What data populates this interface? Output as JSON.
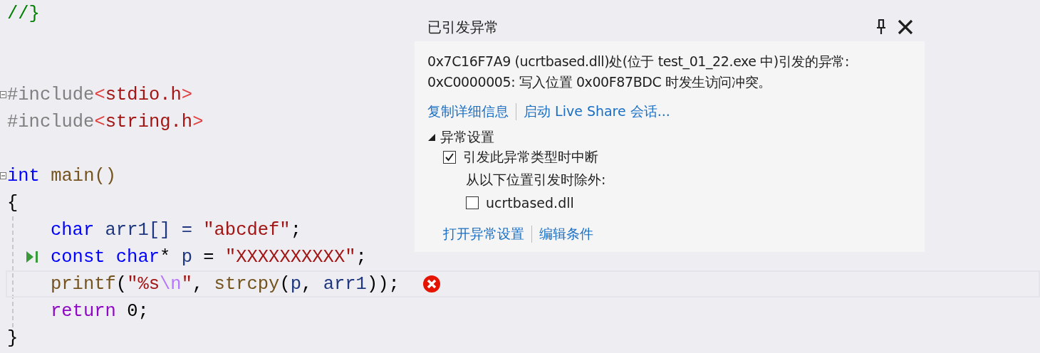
{
  "editor": {
    "lines": [
      {
        "current": false,
        "fold": false,
        "next_statement": false,
        "error": false,
        "tokens": [
          {
            "text": "//}",
            "kind": "comment"
          }
        ]
      },
      {
        "current": false,
        "fold": false,
        "next_statement": false,
        "error": false
      },
      {
        "current": false,
        "fold": false,
        "next_statement": false,
        "error": false
      },
      {
        "current": false,
        "fold": true,
        "next_statement": false,
        "error": false,
        "tokens": [
          {
            "text": "#include",
            "kind": "preproc"
          },
          {
            "text": "<",
            "kind": "angle"
          },
          {
            "text": "stdio.h",
            "kind": "string"
          },
          {
            "text": ">",
            "kind": "angle"
          }
        ]
      },
      {
        "current": false,
        "fold": false,
        "next_statement": false,
        "error": false,
        "tokens": [
          {
            "text": "#include",
            "kind": "preproc"
          },
          {
            "text": "<",
            "kind": "angle"
          },
          {
            "text": "string.h",
            "kind": "string"
          },
          {
            "text": ">",
            "kind": "angle"
          }
        ]
      },
      {
        "current": false,
        "fold": false,
        "next_statement": false,
        "error": false
      },
      {
        "current": false,
        "fold": true,
        "next_statement": false,
        "error": false,
        "tokens": [
          {
            "text": "int",
            "kind": "keyword"
          },
          {
            "text": " main()",
            "kind": "function"
          }
        ]
      },
      {
        "current": false,
        "fold": false,
        "next_statement": false,
        "error": false,
        "tokens": [
          {
            "text": "{",
            "kind": "plain"
          }
        ],
        "children": [
          {
            "current": false,
            "fold": false,
            "next_statement": false,
            "error": false,
            "tokens": [
              {
                "text": "char",
                "kind": "keyword"
              },
              {
                "text": " arr1[] = ",
                "kind": "variable"
              },
              {
                "text": "\"abcdef\"",
                "kind": "string"
              },
              {
                "text": ";",
                "kind": "plain"
              }
            ]
          },
          {
            "current": false,
            "fold": false,
            "next_statement": true,
            "error": false,
            "tokens": [
              {
                "text": "const",
                "kind": "keyword"
              },
              {
                "text": " char",
                "kind": "keyword"
              },
              {
                "text": "* ",
                "kind": "plain"
              },
              {
                "text": "p",
                "kind": "variable"
              },
              {
                "text": " = ",
                "kind": "plain"
              },
              {
                "text": "\"XXXXXXXXXX\"",
                "kind": "string"
              },
              {
                "text": ";",
                "kind": "plain"
              }
            ]
          },
          {
            "current": true,
            "fold": false,
            "next_statement": false,
            "error": true,
            "tokens": [
              {
                "text": "printf",
                "kind": "function"
              },
              {
                "text": "(",
                "kind": "plain"
              },
              {
                "text": "\"%s",
                "kind": "string"
              },
              {
                "text": "\\n",
                "kind": "escape"
              },
              {
                "text": "\"",
                "kind": "string"
              },
              {
                "text": ", ",
                "kind": "plain"
              },
              {
                "text": "strcpy",
                "kind": "function"
              },
              {
                "text": "(",
                "kind": "plain"
              },
              {
                "text": "p",
                "kind": "variable"
              },
              {
                "text": ", ",
                "kind": "plain"
              },
              {
                "text": "arr1",
                "kind": "variable"
              },
              {
                "text": "));",
                "kind": "plain"
              }
            ]
          },
          {
            "current": false,
            "fold": false,
            "next_statement": false,
            "error": false,
            "tokens": [
              {
                "text": "return",
                "kind": "control"
              },
              {
                "text": " 0;",
                "kind": "plain"
              }
            ]
          }
        ]
      },
      {
        "current": false,
        "fold": false,
        "next_statement": false,
        "error": false,
        "tokens": [
          {
            "text": "}",
            "kind": "plain"
          }
        ]
      }
    ]
  },
  "popup": {
    "title": "已引发异常",
    "message": [
      "0x7C16F7A9 (ucrtbased.dll)处(位于 test_01_22.exe 中)引发的异常:",
      "0xC0000005: 写入位置 0x00F87BDC 时发生访问冲突。"
    ],
    "links": [
      "复制详细信息",
      "启动 Live Share 会话..."
    ],
    "settings": {
      "label": "异常设置",
      "expanded": true,
      "break_option": {
        "label": "引发此异常类型时中断",
        "checked": true
      },
      "except_label": "从以下位置引发时除外:",
      "exceptions": [
        {
          "label": "ucrtbased.dll",
          "checked": false
        }
      ],
      "links": [
        "打开异常设置",
        "编辑条件"
      ]
    }
  }
}
